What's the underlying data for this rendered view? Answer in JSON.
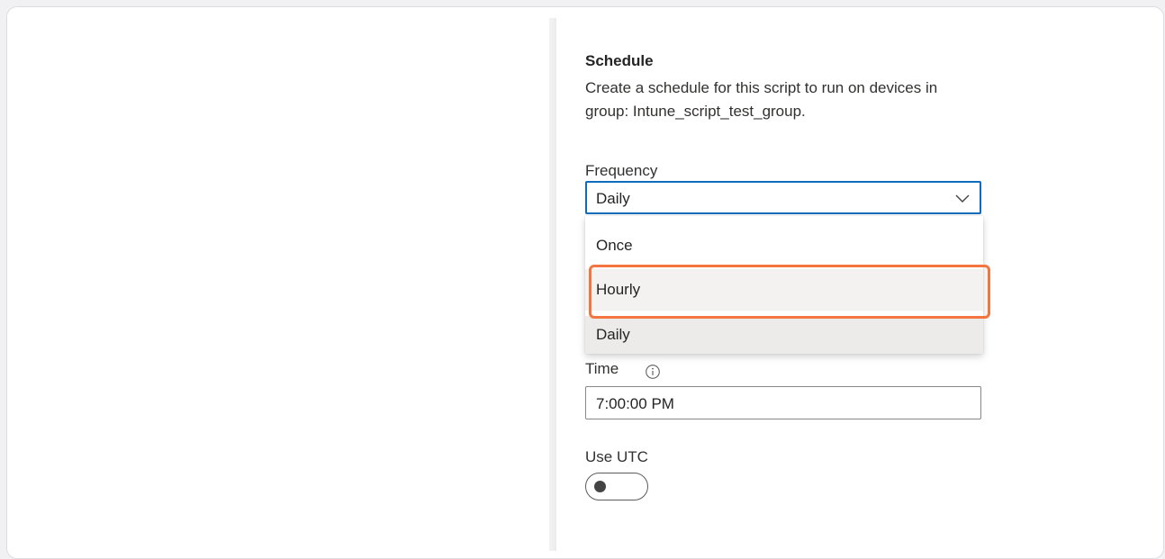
{
  "schedule": {
    "title": "Schedule",
    "description": "Create a schedule for this script to run on devices in group: Intune_script_test_group."
  },
  "frequency": {
    "label": "Frequency",
    "selected": "Daily",
    "options": [
      "Once",
      "Hourly",
      "Daily"
    ]
  },
  "time": {
    "label": "Time",
    "value": "7:00:00 PM"
  },
  "use_utc": {
    "label": "Use UTC",
    "enabled": false
  },
  "colors": {
    "accent": "#0f6cbd",
    "highlight": "#f4753f"
  },
  "icons": {
    "dropdown": "chevron-down-icon",
    "time_info": "info-icon"
  }
}
